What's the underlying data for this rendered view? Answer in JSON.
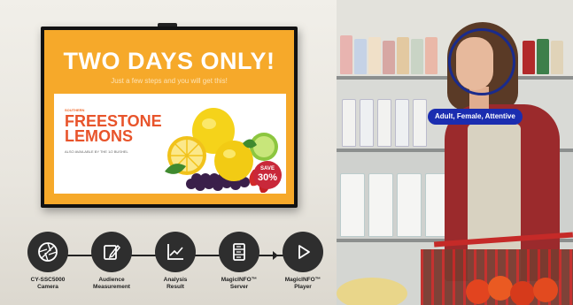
{
  "display": {
    "headline": "TWO DAYS ONLY!",
    "subline": "Just a few steps and you will get this!",
    "card": {
      "kicker": "SOUTHERN",
      "title_line1": "FREESTONE",
      "title_line2": "LEMONS",
      "subtitle": "ALSO AVAILABLE BY THE 1/2 BUSHEL"
    },
    "badge": {
      "top": "SAVE",
      "value": "30%"
    }
  },
  "detection": {
    "label": "Adult, Female, Attentive"
  },
  "pipeline": {
    "steps": [
      {
        "line1": "CY-SSC5000",
        "line2": "Camera",
        "icon": "camera-aperture-icon"
      },
      {
        "line1": "Audience",
        "line2": "Measurement",
        "icon": "edit-note-icon"
      },
      {
        "line1": "Analysis",
        "line2": "Result",
        "icon": "line-chart-icon"
      },
      {
        "line1": "MagicINFO™",
        "line2": "Server",
        "icon": "server-icon"
      },
      {
        "line1": "MagicINFO™",
        "line2": "Player",
        "icon": "play-icon"
      }
    ]
  },
  "colors": {
    "screen_orange": "#f6a92a",
    "title_orange": "#e8542b",
    "badge_red": "#c9283a",
    "detection_blue": "#1b2db0",
    "step_dark": "#2e2e2e"
  }
}
